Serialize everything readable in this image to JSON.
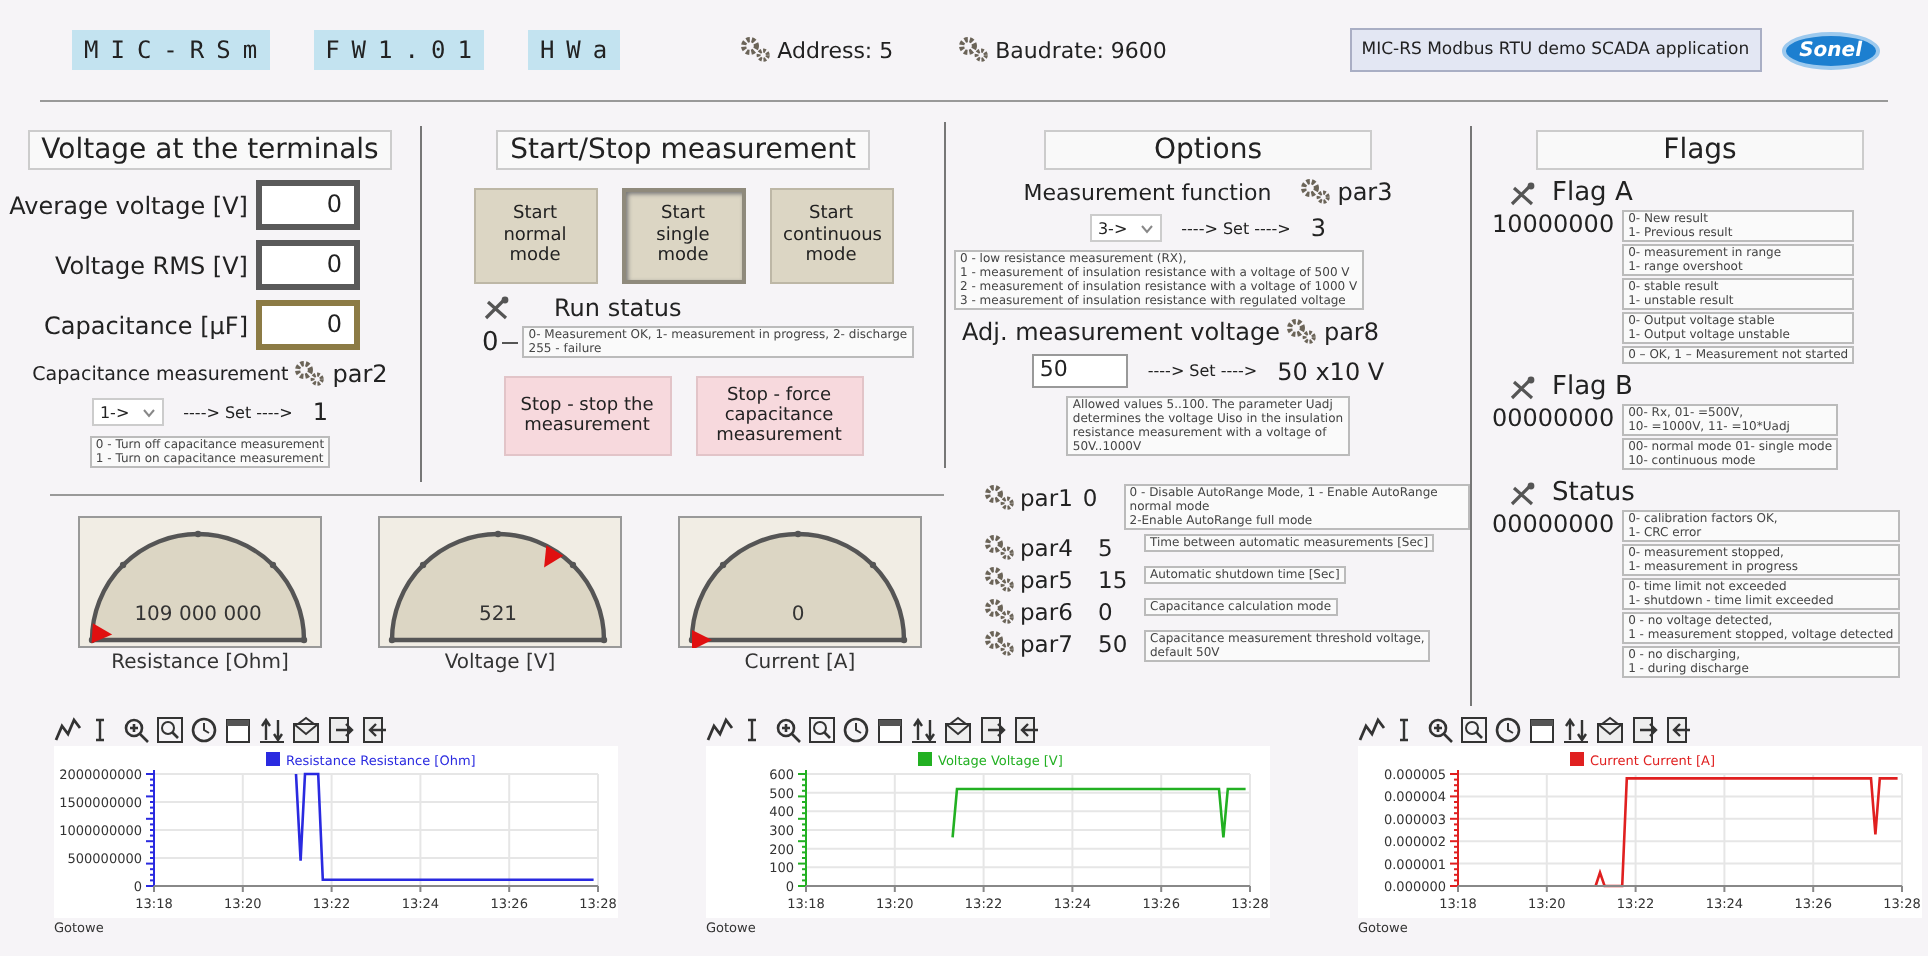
{
  "header": {
    "lcd": [
      "MIC-RSm",
      "FW1.01",
      "HWa"
    ],
    "address": "Address: 5",
    "baudrate": "Baudrate: 9600",
    "app_title": "MIC-RS Modbus RTU demo SCADA application",
    "logo": "Sonel"
  },
  "terminals": {
    "title": "Voltage at the terminals",
    "fields": [
      {
        "label": "Average voltage [V]",
        "value": "0",
        "kind": "plain"
      },
      {
        "label": "Voltage RMS [V]",
        "value": "0",
        "kind": "plain"
      },
      {
        "label": "Capacitance [µF]",
        "value": "0",
        "kind": "accent"
      }
    ],
    "capacitance": {
      "label": "Capacitance measurement",
      "param": "par2",
      "select": "1->",
      "set_label": "----> Set ---->",
      "value": "1",
      "help": [
        "0 - Turn off capacitance measurement",
        "1 - Turn on capacitance measurement"
      ]
    }
  },
  "start_stop": {
    "title": "Start/Stop measurement",
    "start_buttons": [
      {
        "label": "Start normal mode",
        "selected": false
      },
      {
        "label": "Start single mode",
        "selected": true
      },
      {
        "label": "Start continuous mode",
        "selected": false
      }
    ],
    "run_status": {
      "label": "Run status",
      "value": "0",
      "help": [
        "0- Measurement OK, 1- measurement in progress, 2- discharge",
        "255 - failure"
      ]
    },
    "stop_buttons": [
      "Stop - stop the measurement",
      "Stop -  force capacitance measurement"
    ]
  },
  "options": {
    "title": "Options",
    "function": {
      "label": "Measurement function",
      "param": "par3",
      "select": "3->",
      "set_label": "----> Set ---->",
      "value": "3",
      "help": [
        "0 - low resistance measurement (RX),",
        "1 - measurement of insulation resistance with a voltage of 500 V",
        "2 - measurement of insulation resistance with a voltage of 1000 V",
        "3 - measurement of insulation resistance with regulated voltage"
      ]
    },
    "voltage": {
      "label": "Adj. measurement voltage",
      "param": "par8",
      "input": "50",
      "set_label": "----> Set ---->",
      "value": "50 x10 V",
      "help": [
        "Allowed values 5..100. The parameter Uadj",
        "determines the voltage Uiso in the insulation",
        "resistance measurement with a voltage of",
        "50V..1000V"
      ]
    },
    "params": [
      {
        "name": "par1",
        "value": "0",
        "help": [
          "0 - Disable AutoRange Mode, 1 - Enable AutoRange normal mode",
          "2-Enable AutoRange full mode"
        ]
      },
      {
        "name": "par4",
        "value": "5",
        "help": [
          "Time between automatic measurements [Sec]"
        ]
      },
      {
        "name": "par5",
        "value": "15",
        "help": [
          "Automatic shutdown time [Sec]"
        ]
      },
      {
        "name": "par6",
        "value": "0",
        "help": [
          "Capacitance calculation mode"
        ]
      },
      {
        "name": "par7",
        "value": "50",
        "help": [
          "Capacitance measurement threshold voltage,",
          "default 50V"
        ]
      }
    ]
  },
  "flags": {
    "title": "Flags",
    "groups": [
      {
        "name": "Flag A",
        "value": "10000000",
        "notes": [
          [
            "0- New result",
            "1- Previous result"
          ],
          [
            "0- measurement in range",
            "1- range overshoot"
          ],
          [
            "0- stable result",
            "1- unstable result"
          ],
          [
            "0- Output voltage stable",
            "1- Output voltage unstable"
          ],
          [
            "0 – OK,  1 – Measurement not started"
          ]
        ]
      },
      {
        "name": "Flag B",
        "value": "00000000",
        "notes": [
          [
            "00- Rx,  01- =500V,",
            "10- =1000V, 11- =10*Uadj"
          ],
          [
            "00- normal mode 01- single mode",
            "10- continuous mode"
          ]
        ]
      },
      {
        "name": "Status",
        "value": "00000000",
        "notes": [
          [
            "0- calibration factors OK,",
            "1- CRC error"
          ],
          [
            "0- measurement stopped,",
            "1- measurement in progress"
          ],
          [
            "0- time limit not exceeded",
            "1- shutdown - time limit exceeded"
          ],
          [
            "0 - no voltage detected,",
            "1 - measurement stopped, voltage detected"
          ],
          [
            "0 - no discharging,",
            "1 - during discharge"
          ]
        ]
      }
    ]
  },
  "gauges": [
    {
      "label": "Resistance [Ohm]",
      "value": "109 000 000"
    },
    {
      "label": "Voltage [V]",
      "value": "521"
    },
    {
      "label": "Current [A]",
      "value": "0"
    }
  ],
  "charts": [
    {
      "status": "Gotowe",
      "chart_data": {
        "type": "line",
        "grid": true,
        "ylim": [
          0,
          2000000000
        ],
        "yticks": [
          0,
          500000000,
          1000000000,
          1500000000,
          2000000000
        ],
        "categories": [
          "13:18",
          null,
          null,
          null,
          null,
          null,
          null,
          null,
          null,
          null,
          null,
          null,
          null,
          null,
          null,
          null,
          null,
          null,
          null,
          null,
          "13:20",
          null,
          null,
          null,
          null,
          null,
          null,
          null,
          null,
          null,
          null,
          null,
          null,
          null,
          null,
          null,
          null,
          null,
          null,
          null,
          "13:22",
          null,
          null,
          null,
          null,
          null,
          null,
          null,
          null,
          null,
          null,
          null,
          null,
          null,
          null,
          null,
          null,
          null,
          null,
          null,
          "13:24",
          null,
          null,
          null,
          null,
          null,
          null,
          null,
          null,
          null,
          null,
          null,
          null,
          null,
          null,
          null,
          null,
          null,
          null,
          null,
          "13:26",
          null,
          null,
          null,
          null,
          null,
          null,
          null,
          null,
          null,
          null,
          null,
          null,
          null,
          null,
          null,
          null,
          null,
          null,
          null,
          "13:28"
        ],
        "series": [
          {
            "name": "Resistance Resistance [Ohm]",
            "color": "#2a2ae0",
            "values": [
              null,
              null,
              null,
              null,
              null,
              null,
              null,
              null,
              null,
              null,
              null,
              null,
              null,
              null,
              null,
              null,
              null,
              null,
              null,
              null,
              null,
              null,
              null,
              null,
              null,
              null,
              null,
              null,
              null,
              null,
              null,
              null,
              2000000000,
              450000000,
              2000000000,
              2000000000,
              2000000000,
              2000000000,
              110000000,
              110000000,
              110000000,
              110000000,
              110000000,
              110000000,
              110000000,
              110000000,
              110000000,
              110000000,
              110000000,
              110000000,
              110000000,
              110000000,
              110000000,
              110000000,
              110000000,
              110000000,
              110000000,
              110000000,
              110000000,
              110000000,
              110000000,
              110000000,
              110000000,
              110000000,
              110000000,
              110000000,
              110000000,
              110000000,
              110000000,
              110000000,
              110000000,
              110000000,
              110000000,
              110000000,
              110000000,
              110000000,
              110000000,
              110000000,
              110000000,
              110000000,
              110000000,
              110000000,
              110000000,
              110000000,
              110000000,
              110000000,
              110000000,
              110000000,
              110000000,
              110000000,
              110000000,
              110000000,
              110000000,
              110000000,
              110000000,
              110000000,
              110000000,
              110000000,
              110000000,
              110000000,
              null
            ]
          }
        ]
      }
    },
    {
      "status": "Gotowe",
      "chart_data": {
        "type": "line",
        "grid": true,
        "ylim": [
          0,
          600
        ],
        "yticks": [
          0,
          100,
          200,
          300,
          400,
          500,
          600
        ],
        "categories": [
          "13:18",
          null,
          null,
          null,
          null,
          null,
          null,
          null,
          null,
          null,
          null,
          null,
          null,
          null,
          null,
          null,
          null,
          null,
          null,
          null,
          "13:20",
          null,
          null,
          null,
          null,
          null,
          null,
          null,
          null,
          null,
          null,
          null,
          null,
          null,
          null,
          null,
          null,
          null,
          null,
          null,
          "13:22",
          null,
          null,
          null,
          null,
          null,
          null,
          null,
          null,
          null,
          null,
          null,
          null,
          null,
          null,
          null,
          null,
          null,
          null,
          null,
          "13:24",
          null,
          null,
          null,
          null,
          null,
          null,
          null,
          null,
          null,
          null,
          null,
          null,
          null,
          null,
          null,
          null,
          null,
          null,
          null,
          "13:26",
          null,
          null,
          null,
          null,
          null,
          null,
          null,
          null,
          null,
          null,
          null,
          null,
          null,
          null,
          null,
          null,
          null,
          null,
          null,
          "13:28"
        ],
        "series": [
          {
            "name": "Voltage Voltage [V]",
            "color": "#22b022",
            "values": [
              null,
              null,
              null,
              null,
              null,
              null,
              null,
              null,
              null,
              null,
              null,
              null,
              null,
              null,
              null,
              null,
              null,
              null,
              null,
              null,
              null,
              null,
              null,
              null,
              null,
              null,
              null,
              null,
              null,
              null,
              null,
              null,
              null,
              260,
              520,
              520,
              520,
              520,
              520,
              520,
              520,
              520,
              520,
              520,
              520,
              520,
              520,
              520,
              520,
              520,
              520,
              520,
              520,
              520,
              520,
              520,
              520,
              520,
              520,
              520,
              520,
              520,
              520,
              520,
              520,
              520,
              520,
              520,
              520,
              520,
              520,
              520,
              520,
              520,
              520,
              520,
              520,
              520,
              520,
              520,
              520,
              520,
              520,
              520,
              520,
              520,
              520,
              520,
              520,
              520,
              520,
              520,
              520,
              520,
              260,
              520,
              520,
              520,
              520,
              520,
              null
            ]
          }
        ]
      }
    },
    {
      "status": "Gotowe",
      "chart_data": {
        "type": "line",
        "grid": true,
        "ylim": [
          0,
          5e-06
        ],
        "categories": [
          "13:18",
          null,
          null,
          null,
          null,
          null,
          null,
          null,
          null,
          null,
          null,
          null,
          null,
          null,
          null,
          null,
          null,
          null,
          null,
          null,
          "13:20",
          null,
          null,
          null,
          null,
          null,
          null,
          null,
          null,
          null,
          null,
          null,
          null,
          null,
          null,
          null,
          null,
          null,
          null,
          null,
          "13:22",
          null,
          null,
          null,
          null,
          null,
          null,
          null,
          null,
          null,
          null,
          null,
          null,
          null,
          null,
          null,
          null,
          null,
          null,
          null,
          "13:24",
          null,
          null,
          null,
          null,
          null,
          null,
          null,
          null,
          null,
          null,
          null,
          null,
          null,
          null,
          null,
          null,
          null,
          null,
          null,
          "13:26",
          null,
          null,
          null,
          null,
          null,
          null,
          null,
          null,
          null,
          null,
          null,
          null,
          null,
          null,
          null,
          null,
          null,
          null,
          null,
          "13:28"
        ],
        "yticks": [
          {
            "value": 0,
            "label": "0.000000"
          },
          {
            "value": 1e-06,
            "label": "0.000001"
          },
          {
            "value": 2e-06,
            "label": "0.000002"
          },
          {
            "value": 3e-06,
            "label": "0.000003"
          },
          {
            "value": 4e-06,
            "label": "0.000004"
          },
          {
            "value": 5e-06,
            "label": "0.000005"
          }
        ],
        "series": [
          {
            "name": "Current Current [A]",
            "color": "#e02020",
            "values": [
              null,
              null,
              null,
              null,
              null,
              null,
              null,
              null,
              null,
              null,
              null,
              null,
              null,
              null,
              null,
              null,
              null,
              null,
              null,
              null,
              null,
              null,
              null,
              null,
              null,
              null,
              null,
              null,
              null,
              null,
              null,
              0,
              6e-07,
              0,
              0,
              0,
              0,
              0,
              4.8e-06,
              4.8e-06,
              4.8e-06,
              4.8e-06,
              4.8e-06,
              4.8e-06,
              4.8e-06,
              4.8e-06,
              4.8e-06,
              4.8e-06,
              4.8e-06,
              4.8e-06,
              4.8e-06,
              4.8e-06,
              4.8e-06,
              4.8e-06,
              4.8e-06,
              4.8e-06,
              4.8e-06,
              4.8e-06,
              4.8e-06,
              4.8e-06,
              4.8e-06,
              4.8e-06,
              4.8e-06,
              4.8e-06,
              4.8e-06,
              4.8e-06,
              4.8e-06,
              4.8e-06,
              4.8e-06,
              4.8e-06,
              4.8e-06,
              4.8e-06,
              4.8e-06,
              4.8e-06,
              4.8e-06,
              4.8e-06,
              4.8e-06,
              4.8e-06,
              4.8e-06,
              4.8e-06,
              4.8e-06,
              4.8e-06,
              4.8e-06,
              4.8e-06,
              4.8e-06,
              4.8e-06,
              4.8e-06,
              4.8e-06,
              4.8e-06,
              4.8e-06,
              4.8e-06,
              4.8e-06,
              4.8e-06,
              4.8e-06,
              2.3e-06,
              4.8e-06,
              4.8e-06,
              4.8e-06,
              4.8e-06,
              4.8e-06,
              null
            ]
          }
        ]
      }
    }
  ]
}
